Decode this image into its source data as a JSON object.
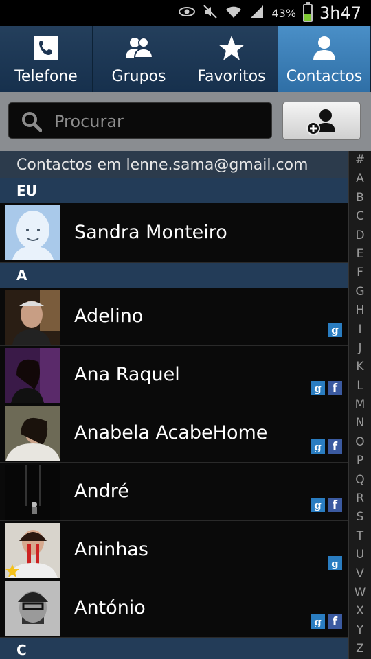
{
  "status": {
    "battery_pct": "43%",
    "battery_level": 0.43,
    "time": "3h47"
  },
  "tabs": [
    {
      "label": "Telefone",
      "icon": "phone-icon",
      "active": false
    },
    {
      "label": "Grupos",
      "icon": "groups-icon",
      "active": false
    },
    {
      "label": "Favoritos",
      "icon": "star-icon",
      "active": false
    },
    {
      "label": "Contactos",
      "icon": "person-icon",
      "active": true
    }
  ],
  "search": {
    "placeholder": "Procurar"
  },
  "account_header": "Contactos em lenne.sama@gmail.com",
  "sections": {
    "me": "EU",
    "a": "A",
    "c": "C"
  },
  "me": {
    "name": "Sandra Monteiro"
  },
  "contacts": [
    {
      "name": "Adelino",
      "sources": [
        "google"
      ]
    },
    {
      "name": "Ana Raquel",
      "sources": [
        "google",
        "facebook"
      ]
    },
    {
      "name": "Anabela AcabeHome",
      "sources": [
        "google",
        "facebook"
      ]
    },
    {
      "name": "André",
      "sources": [
        "google",
        "facebook"
      ]
    },
    {
      "name": "Aninhas",
      "sources": [
        "google"
      ],
      "favorite": true
    },
    {
      "name": "António",
      "sources": [
        "google",
        "facebook"
      ]
    }
  ],
  "badge_glyphs": {
    "google": "g",
    "facebook": "f"
  },
  "index": [
    "#",
    "A",
    "B",
    "C",
    "D",
    "E",
    "F",
    "G",
    "H",
    "I",
    "J",
    "K",
    "L",
    "M",
    "N",
    "O",
    "P",
    "Q",
    "R",
    "S",
    "T",
    "U",
    "V",
    "W",
    "X",
    "Y",
    "Z"
  ],
  "colors": {
    "active_tab": "#3f83bd",
    "section_bar": "#233c58",
    "google_badge": "#2a7dc1",
    "facebook_badge": "#3b5aa0"
  }
}
